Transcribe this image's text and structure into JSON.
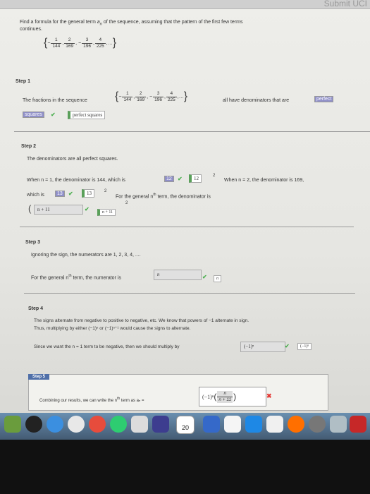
{
  "window": {
    "corner_text": "Submit UCI"
  },
  "problem": {
    "text": "Find a formula for the general term aₙ of the sequence, assuming that the pattern of the first few terms continues.",
    "terms": [
      {
        "sign": "-",
        "num": "1",
        "den": "144"
      },
      {
        "sign": "",
        "num": "2",
        "den": "169"
      },
      {
        "sign": "-",
        "num": "3",
        "den": "196"
      },
      {
        "sign": "",
        "num": "4",
        "den": "225"
      }
    ],
    "ellipsis": "…"
  },
  "step1": {
    "label": "Step 1",
    "text_before": "The fractions in the sequence",
    "text_after": "all have denominators that are",
    "answer_part1": "perfect",
    "answer_part2": "squares",
    "correct_box": "perfect squares"
  },
  "step2": {
    "label": "Step 2",
    "intro": "The denominators are all perfect squares.",
    "line1_prefix": "When n = 1, the denominator is 144, which is",
    "ans_12": "12",
    "box_12": "12",
    "exp": "2",
    "line1_suffix": "When n = 2, the denominator is 169,",
    "line2_prefix": "which is",
    "ans_13": "13",
    "box_13": "13",
    "line2_suffix": "For the general n",
    "line2_sup": "th",
    "line2_end": "term, the denominator is",
    "ans_formula": "n + 11",
    "box_formula": "n + 11"
  },
  "step3": {
    "label": "Step 3",
    "intro": "Ignoring the sign, the numerators are 1, 2, 3, 4, ....",
    "line_prefix": "For the general n",
    "line_sup": "th",
    "line_end": "term, the numerator is",
    "answer": "n",
    "box": "n"
  },
  "step4": {
    "label": "Step 4",
    "line1": "The signs alternate from negative to positive to negative, etc. We know that powers of −1 alternate in sign.",
    "line2": "Thus, multiplying by either (−1)ⁿ or (−1)ⁿ⁺¹ would cause the signs to alternate.",
    "line3": "Since we want the n = 1 term to be negative, then we should multiply by",
    "answer": "(−1)ⁿ",
    "box": "(−1)ⁿ"
  },
  "step5": {
    "label": "Step 5",
    "line": "Combining our results, we can write the n",
    "line_sup": "th",
    "line_end": "term as aₙ =",
    "answer_sign": "(−1)ⁿ",
    "answer_num": "n",
    "answer_den": "n + 11"
  },
  "dock": {
    "calendar_day": "20"
  }
}
